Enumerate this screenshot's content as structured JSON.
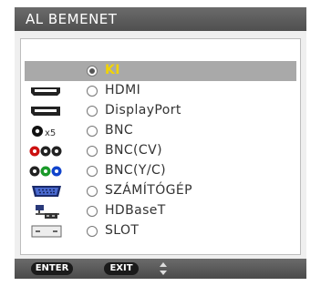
{
  "window": {
    "title": "AL BEMENET"
  },
  "inputs": [
    {
      "icon": "selection-indicator-icon",
      "label": "KI",
      "selected": true
    },
    {
      "icon": "hdmi-port-icon",
      "label": "HDMI",
      "selected": false
    },
    {
      "icon": "displayport-icon",
      "label": "DisplayPort",
      "selected": false
    },
    {
      "icon": "bnc-x5-icon",
      "label": "BNC",
      "icon_text": "x5",
      "selected": false
    },
    {
      "icon": "bnc-cv-icon",
      "label": "BNC(CV)",
      "selected": false
    },
    {
      "icon": "bnc-yc-icon",
      "label": "BNC(Y/C)",
      "selected": false
    },
    {
      "icon": "vga-port-icon",
      "label": "SZÁMÍTÓGÉP",
      "selected": false
    },
    {
      "icon": "network-icon",
      "label": "HDBaseT",
      "selected": false
    },
    {
      "icon": "slot-icon",
      "label": "SLOT",
      "selected": false
    }
  ],
  "footer": {
    "enter_label": "ENTER",
    "exit_label": "EXIT",
    "navigate_icon": "up-down-arrow-icon"
  },
  "colors": {
    "title_bg": "#5a5a5a",
    "selected_row_bg": "#a9a9a9",
    "selected_text": "#f2d400",
    "text": "#333333"
  }
}
